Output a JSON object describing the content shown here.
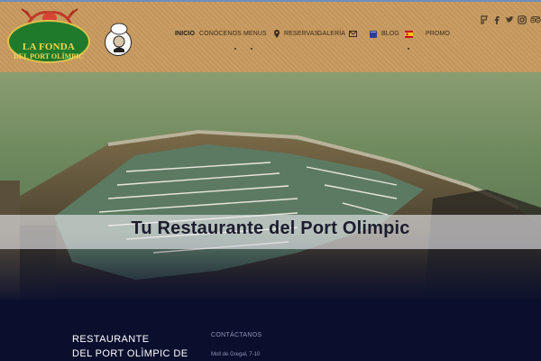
{
  "logo": {
    "line1": "LA FONDA",
    "line2": "DEL PORT OLÍMPIC"
  },
  "nav": {
    "items": [
      {
        "label": "INICIO",
        "active": true
      },
      {
        "label": "CONÓCENOS"
      },
      {
        "label": "MENUS"
      },
      {
        "label": "RESERVAS",
        "icon": "map-pin-icon"
      },
      {
        "label": "GALERÍA"
      },
      {
        "label": "",
        "icon": "envelope-icon"
      },
      {
        "label": "BLOG",
        "icon": "book-icon"
      },
      {
        "label": "",
        "icon": "spain-flag-icon"
      },
      {
        "label": "PROMO"
      }
    ]
  },
  "social": [
    "foursquare-icon",
    "facebook-icon",
    "twitter-icon",
    "instagram-icon",
    "tripadvisor-icon"
  ],
  "hero": {
    "title": "Tu Restaurante del Port Olimpic"
  },
  "footer": {
    "title_line1": "RESTAURANTE",
    "title_line2": "DEL PORT OLÌMPIC DE",
    "contact_heading": "CONTÁCTANOS",
    "address": "Moll de Gregal, 7-10"
  },
  "colors": {
    "header_bg": "#c79a5e",
    "footer_bg": "#0a0f2e",
    "logo_green": "#1f7a2c",
    "logo_gold": "#f3d64d"
  }
}
